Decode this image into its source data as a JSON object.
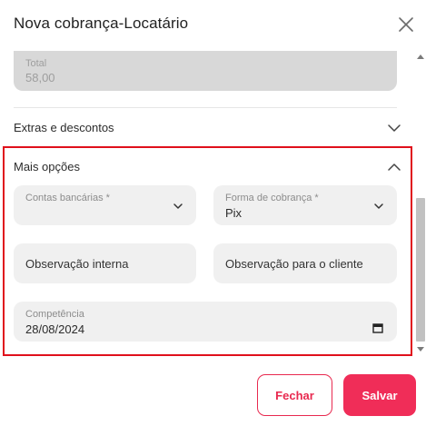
{
  "modal": {
    "title": "Nova cobrança-Locatário",
    "close_icon": "close-icon"
  },
  "total": {
    "label": "Total",
    "value": "58,00"
  },
  "sections": {
    "extras": {
      "label": "Extras e descontos",
      "expanded": false
    },
    "mais_opcoes": {
      "label": "Mais opções",
      "expanded": true
    }
  },
  "fields": {
    "contas_bancarias": {
      "label": "Contas bancárias *",
      "value": ""
    },
    "forma_cobranca": {
      "label": "Forma de cobrança *",
      "value": "Pix"
    },
    "observacao_interna": {
      "placeholder": "Observação interna"
    },
    "observacao_cliente": {
      "placeholder": "Observação para o cliente"
    },
    "competencia": {
      "label": "Competência",
      "value": "28/08/2024"
    }
  },
  "buttons": {
    "fechar": "Fechar",
    "salvar": "Salvar"
  },
  "colors": {
    "accent": "#f02d58",
    "highlight_border": "#e0101c",
    "field_bg": "#f0f0f0"
  }
}
